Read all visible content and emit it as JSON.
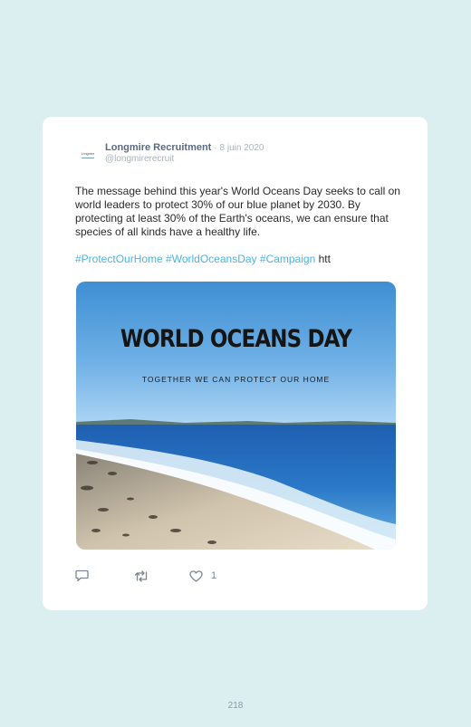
{
  "tweet": {
    "avatar_text": "Longmire",
    "author_name": "Longmire Recruitment",
    "date": "· 8 juin 2020",
    "handle": "@longmirerecruit",
    "body": "The message behind this year's World Oceans Day seeks to call on world leaders to protect 30% of our blue planet by 2030. By protecting at least 30% of the Earth's oceans, we can ensure that species of all kinds have a healthy life.",
    "hashtags": [
      "#ProtectOurHome",
      "#WorldOceansDay",
      "#Campaign"
    ],
    "truncated_link": "htt",
    "media": {
      "title": "WORLD OCEANS DAY",
      "subtitle": "TOGETHER WE CAN PROTECT OUR HOME"
    },
    "actions": {
      "reply_icon": "comment-icon",
      "retweet_icon": "retweet-icon",
      "like_icon": "heart-icon",
      "like_count": "1"
    }
  },
  "page_number": "218",
  "colors": {
    "background": "#dbeff0",
    "card": "#ffffff",
    "hashtag": "#4db3e0",
    "name": "#5a6b80",
    "muted": "#a9b3bd"
  }
}
